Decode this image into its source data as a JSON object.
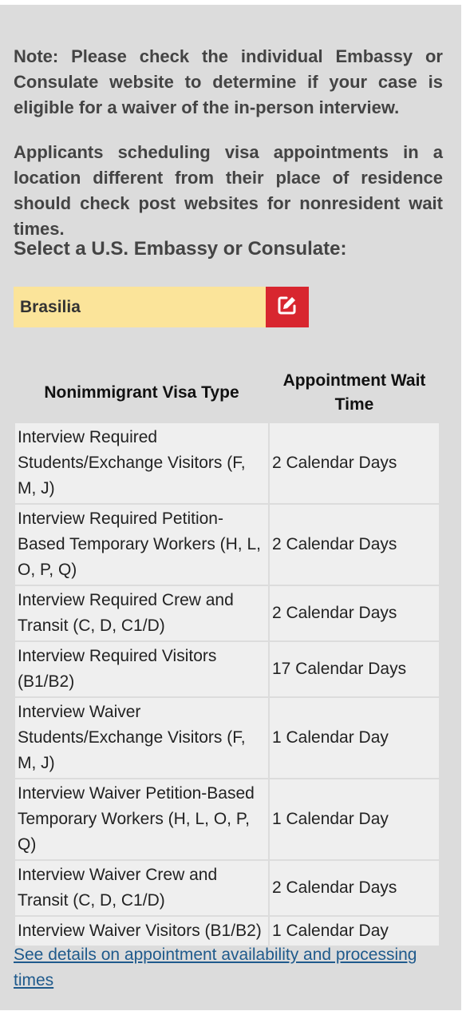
{
  "notes": {
    "note1": "Note: Please check the individual Embassy or Consulate website to determine if your case is eligible for a waiver of the in-person interview.",
    "note2": "Applicants scheduling visa appointments in a location different from their place of residence should check post websites for nonresident wait times."
  },
  "selector": {
    "label": "Select a U.S. Embassy or Consulate:",
    "value": "Brasilia",
    "edit_icon": "edit-icon",
    "accent_color": "#d8262f",
    "field_color": "#fbe49a"
  },
  "table": {
    "headers": [
      "Nonimmigrant Visa Type",
      "Appointment Wait Time"
    ],
    "rows": [
      {
        "type": "Interview Required Students/Exchange Visitors (F, M, J)",
        "wait": "2 Calendar Days"
      },
      {
        "type": "Interview Required Petition-Based Temporary Workers (H, L, O, P, Q)",
        "wait": "2 Calendar Days"
      },
      {
        "type": "Interview Required Crew and Transit (C, D, C1/D)",
        "wait": "2 Calendar Days"
      },
      {
        "type": "Interview Required Visitors (B1/B2)",
        "wait": "17 Calendar Days"
      },
      {
        "type": "Interview Waiver Students/Exchange Visitors (F, M, J)",
        "wait": "1 Calendar Day"
      },
      {
        "type": "Interview Waiver Petition-Based Temporary Workers (H, L, O, P, Q)",
        "wait": "1 Calendar Day"
      },
      {
        "type": "Interview Waiver Crew and Transit (C, D, C1/D)",
        "wait": "2 Calendar Days"
      },
      {
        "type": "Interview Waiver Visitors (B1/B2)",
        "wait": "1 Calendar Day"
      }
    ]
  },
  "link": {
    "label": "See details on appointment availability and processing times"
  }
}
